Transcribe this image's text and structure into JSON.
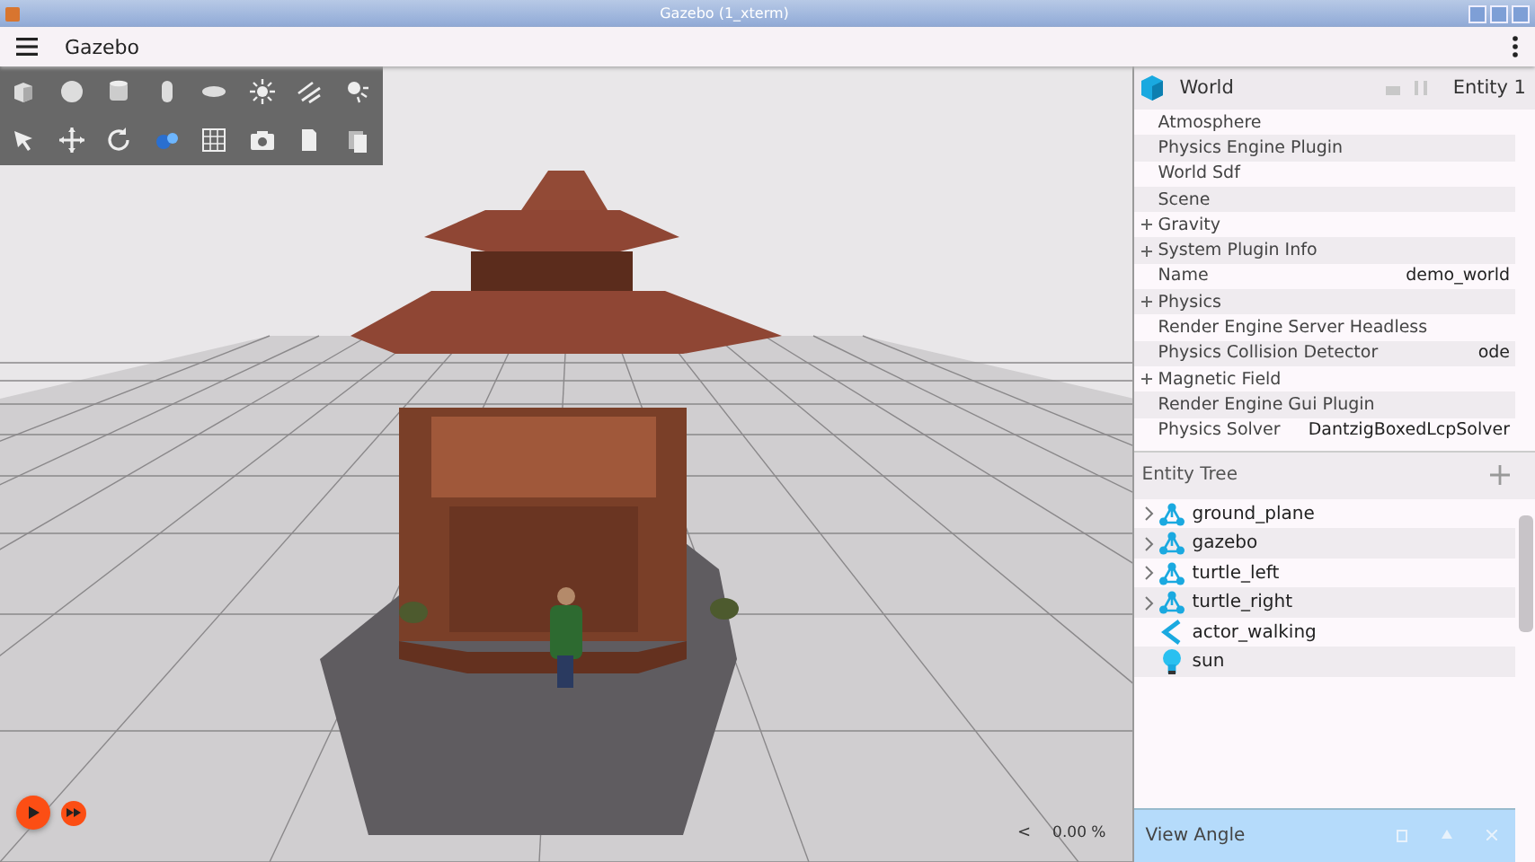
{
  "window": {
    "title": "Gazebo (1_xterm)"
  },
  "app_bar": {
    "title": "Gazebo"
  },
  "component_inspector": {
    "title": "World",
    "entity": "Entity 1",
    "properties": [
      {
        "name": "Atmosphere",
        "expandable": false
      },
      {
        "name": "Physics Engine Plugin",
        "expandable": false
      },
      {
        "name": "World Sdf",
        "expandable": false
      },
      {
        "name": "Scene",
        "expandable": false
      },
      {
        "name": "Gravity",
        "expandable": true
      },
      {
        "name": "System Plugin Info",
        "expandable": true
      },
      {
        "name": "Name",
        "value": "demo_world",
        "expandable": false
      },
      {
        "name": "Physics",
        "expandable": true
      },
      {
        "name": "Render Engine Server Headless",
        "expandable": false
      },
      {
        "name": "Physics Collision Detector",
        "value": "ode",
        "expandable": false
      },
      {
        "name": "Magnetic Field",
        "expandable": true
      },
      {
        "name": "Render Engine Gui Plugin",
        "expandable": false
      },
      {
        "name": "Physics Solver",
        "value": "DantzigBoxedLcpSolver",
        "expandable": false
      }
    ]
  },
  "entity_tree": {
    "title": "Entity Tree",
    "items": [
      {
        "name": "ground_plane",
        "kind": "model",
        "expandable": true
      },
      {
        "name": "gazebo",
        "kind": "model",
        "expandable": true
      },
      {
        "name": "turtle_left",
        "kind": "model",
        "expandable": true
      },
      {
        "name": "turtle_right",
        "kind": "model",
        "expandable": true
      },
      {
        "name": "actor_walking",
        "kind": "actor",
        "expandable": false
      },
      {
        "name": "sun",
        "kind": "light",
        "expandable": false
      }
    ]
  },
  "view_angle": {
    "title": "View Angle"
  },
  "playback": {
    "collapse": "<",
    "rtf": "0.00 %"
  }
}
